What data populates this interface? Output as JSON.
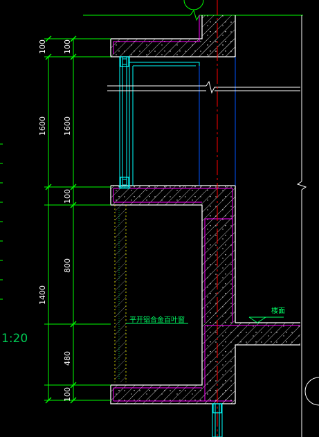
{
  "drawing": {
    "type": "CAD section detail",
    "background": "#000000",
    "colors": {
      "dimension_line": "#00ff00",
      "concrete_outline": "#ffffff",
      "finish_line": "#ff00ff",
      "hatch": "#d4d4d4",
      "window_frame": "#00ffff",
      "center_line": "#ff0000",
      "glass_line": "#0055ff",
      "text_green": "#00ff66"
    },
    "scale_label": "1:20",
    "dimensions_left": [
      "1600",
      "1400"
    ],
    "dimensions_right_top": [
      "100",
      "100",
      "1600",
      "100"
    ],
    "dimensions_right_bottom": [
      "800",
      "480",
      "100"
    ],
    "dimension_100_left": "100",
    "window_label": "平开铝合金百叶窗",
    "level_label": "楼面"
  }
}
